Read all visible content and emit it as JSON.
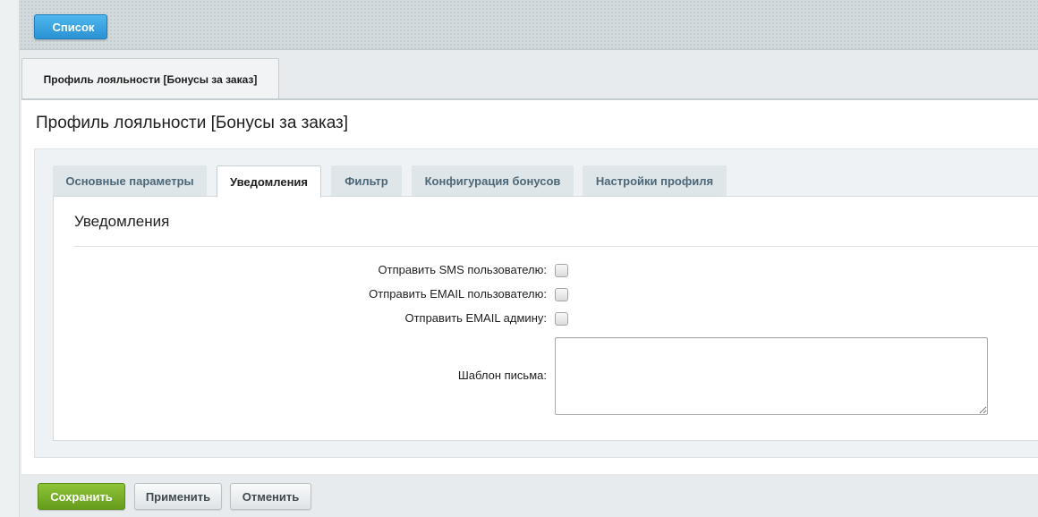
{
  "toolbar": {
    "list_button_label": "Список"
  },
  "page_tab": {
    "label": "Профиль лояльности [Бонусы за заказ]"
  },
  "page": {
    "title": "Профиль лояльности [Бонусы за заказ]"
  },
  "tabs": [
    {
      "label": "Основные параметры",
      "active": false
    },
    {
      "label": "Уведомления",
      "active": true
    },
    {
      "label": "Фильтр",
      "active": false
    },
    {
      "label": "Конфигурация бонусов",
      "active": false
    },
    {
      "label": "Настройки профиля",
      "active": false
    }
  ],
  "notifications": {
    "section_title": "Уведомления",
    "fields": {
      "send_sms_user": {
        "label": "Отправить SMS пользователю:",
        "checked": false
      },
      "send_email_user": {
        "label": "Отправить EMAIL пользователю:",
        "checked": false
      },
      "send_email_admin": {
        "label": "Отправить EMAIL админу:",
        "checked": false
      },
      "email_template": {
        "label": "Шаблон письма:",
        "value": ""
      }
    }
  },
  "actions": {
    "save_label": "Сохранить",
    "apply_label": "Применить",
    "cancel_label": "Отменить"
  },
  "colors": {
    "list_button": "#2b92d3",
    "save_button": "#659d1c",
    "tab_text": "#4d6777"
  }
}
